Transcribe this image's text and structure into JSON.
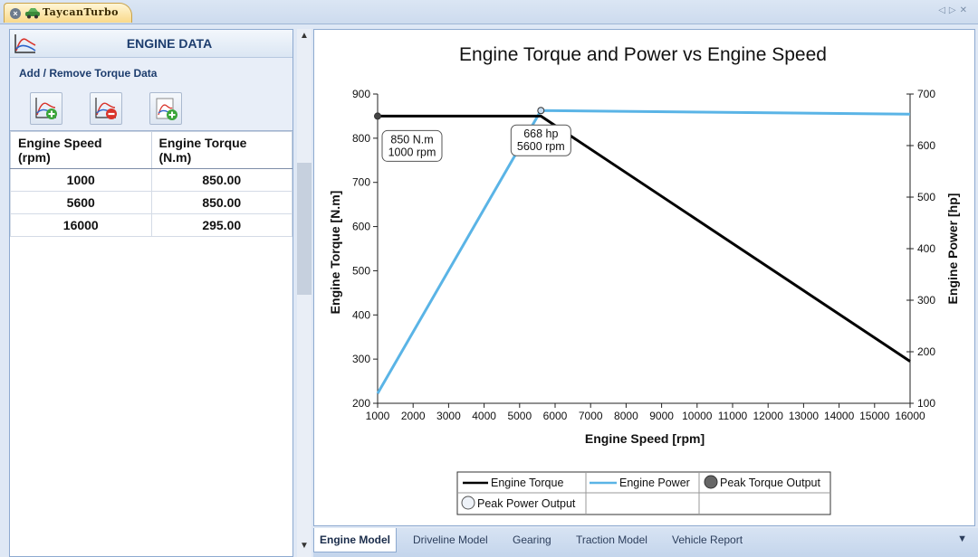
{
  "document_tab": {
    "title": "TaycanTurbo"
  },
  "left_panel": {
    "title": "ENGINE DATA",
    "section_title": "Add / Remove Torque Data",
    "table": {
      "headers": [
        "Engine Speed (rpm)",
        "Engine Torque (N.m)"
      ],
      "header_lines": [
        [
          "Engine Speed",
          "(rpm)"
        ],
        [
          "Engine Torque",
          "(N.m)"
        ]
      ],
      "rows": [
        [
          "1000",
          "850.00"
        ],
        [
          "5600",
          "850.00"
        ],
        [
          "16000",
          "295.00"
        ]
      ]
    }
  },
  "chart_data": {
    "type": "line",
    "title": "Engine Torque and Power vs Engine Speed",
    "xlabel": "Engine Speed [rpm]",
    "ylabel": "Engine Torque [N.m]",
    "y2label": "Engine Power [hp]",
    "xlim": [
      1000,
      16000
    ],
    "ylim": [
      200,
      900
    ],
    "y2lim": [
      100,
      700
    ],
    "xticks": [
      "1000",
      "2000",
      "3000",
      "4000",
      "5000",
      "6000",
      "7000",
      "8000",
      "9000",
      "10000",
      "11000",
      "12000",
      "13000",
      "14000",
      "15000",
      "16000"
    ],
    "yticks": [
      "200",
      "300",
      "400",
      "500",
      "600",
      "700",
      "800",
      "900"
    ],
    "y2ticks": [
      "100",
      "200",
      "300",
      "400",
      "500",
      "600",
      "700"
    ],
    "series": [
      {
        "name": "Engine Torque",
        "axis": "left",
        "color": "#000000",
        "x": [
          1000,
          5600,
          16000
        ],
        "y": [
          850,
          850,
          295
        ]
      },
      {
        "name": "Engine Power",
        "axis": "right",
        "color": "#5ab4e6",
        "x": [
          1000,
          5600,
          16000
        ],
        "y": [
          119,
          668,
          661
        ]
      }
    ],
    "points": [
      {
        "name": "Peak Torque Output",
        "axis": "left",
        "x": 1000,
        "y": 850,
        "color": "#444444"
      },
      {
        "name": "Peak Power Output",
        "axis": "right",
        "x": 5600,
        "y": 668,
        "color": "#c8dcf0"
      }
    ],
    "annotations": [
      {
        "lines": [
          "850 N.m",
          "1000 rpm"
        ]
      },
      {
        "lines": [
          "668 hp",
          "5600 rpm"
        ]
      }
    ],
    "legend": [
      "Engine Torque",
      "Engine Power",
      "Peak Torque Output",
      "Peak Power Output"
    ],
    "legend_position": "bottom-center",
    "grid": false
  },
  "bottom_tabs": [
    {
      "label": "Engine Model",
      "active": true
    },
    {
      "label": "Driveline Model",
      "active": false
    },
    {
      "label": "Gearing",
      "active": false
    },
    {
      "label": "Traction Model",
      "active": false
    },
    {
      "label": "Vehicle Report",
      "active": false
    }
  ]
}
